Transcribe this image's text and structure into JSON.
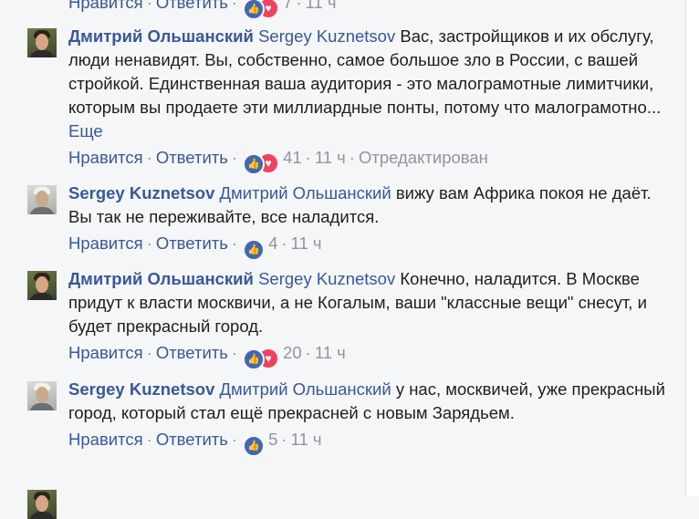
{
  "top_partial": {
    "like_label": "Нравится",
    "reply_label": "Ответить",
    "count": "7",
    "time": "11 ч"
  },
  "comments": [
    {
      "author": "Дмитрий Ольшанский",
      "mention": "Sergey Kuznetsov",
      "text": "Вас, застройщиков и их обслугу, люди ненавидят. Вы, собственно, самое большое зло в России, с вашей стройкой. Единственная ваша аудитория - это малограмотные лимитчики, которым вы продаете эти миллиардные понты, потому что малограмотно...",
      "more_label": "Еще",
      "like_label": "Нравится",
      "reply_label": "Ответить",
      "count": "41",
      "time": "11 ч",
      "edited": "Отредактирован"
    },
    {
      "author": "Sergey Kuznetsov",
      "mention": "Дмитрий Ольшанский",
      "text": "вижу вам Африка покоя не даёт. Вы так не переживайте, все наладится.",
      "like_label": "Нравится",
      "reply_label": "Ответить",
      "count": "4",
      "time": "11 ч"
    },
    {
      "author": "Дмитрий Ольшанский",
      "mention": "Sergey Kuznetsov",
      "text": "Конечно, наладится. В Москве придут к власти москвичи, а не Когалым, ваши \"классные вещи\" снесут, и будет прекрасный город.",
      "like_label": "Нравится",
      "reply_label": "Ответить",
      "count": "20",
      "time": "11 ч"
    },
    {
      "author": "Sergey Kuznetsov",
      "mention": "Дмитрий Ольшанский",
      "text": "у нас, москвичей, уже прекрасный город, который стал ещё прекрасней с новым Зарядьем.",
      "like_label": "Нравится",
      "reply_label": "Ответить",
      "count": "5",
      "time": "11 ч"
    }
  ],
  "colors": {
    "link": "#385898",
    "meta": "#90949c",
    "like": "#4267b2",
    "love": "#f0425f",
    "background": "#f5f6f7"
  },
  "icons": [
    "like-icon",
    "love-icon"
  ]
}
